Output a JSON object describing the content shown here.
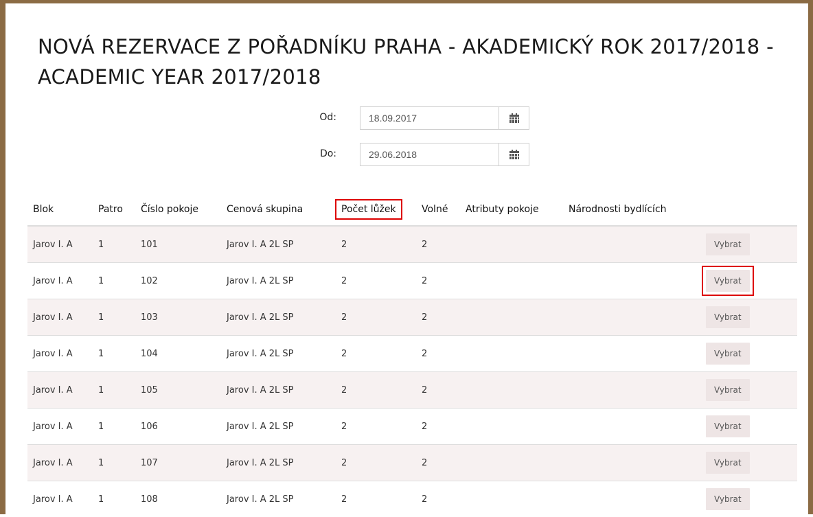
{
  "page": {
    "title": "NOVÁ REZERVACE Z POŘADNÍKU PRAHA - AKADEMICKÝ ROK 2017/2018 - ACADEMIC YEAR 2017/2018"
  },
  "dates": {
    "from_label": "Od:",
    "from_value": "18.09.2017",
    "to_label": "Do:",
    "to_value": "29.06.2018",
    "icon": "calendar-icon"
  },
  "table": {
    "headers": [
      "Blok",
      "Patro",
      "Číslo pokoje",
      "Cenová skupina",
      "Počet lůžek",
      "Volné",
      "Atributy pokoje",
      "Národnosti bydlících",
      ""
    ],
    "highlighted_header": "Počet lůžek",
    "rows": [
      {
        "blok": "Jarov I. A",
        "patro": "1",
        "cislo": "101",
        "cenova": "Jarov I. A 2L SP",
        "pocet": "2",
        "volne": "2",
        "atributy": "",
        "narodnosti": "",
        "action": "Vybrat"
      },
      {
        "blok": "Jarov I. A",
        "patro": "1",
        "cislo": "102",
        "cenova": "Jarov I. A 2L SP",
        "pocet": "2",
        "volne": "2",
        "atributy": "",
        "narodnosti": "",
        "action": "Vybrat"
      },
      {
        "blok": "Jarov I. A",
        "patro": "1",
        "cislo": "103",
        "cenova": "Jarov I. A 2L SP",
        "pocet": "2",
        "volne": "2",
        "atributy": "",
        "narodnosti": "",
        "action": "Vybrat"
      },
      {
        "blok": "Jarov I. A",
        "patro": "1",
        "cislo": "104",
        "cenova": "Jarov I. A 2L SP",
        "pocet": "2",
        "volne": "2",
        "atributy": "",
        "narodnosti": "",
        "action": "Vybrat"
      },
      {
        "blok": "Jarov I. A",
        "patro": "1",
        "cislo": "105",
        "cenova": "Jarov I. A 2L SP",
        "pocet": "2",
        "volne": "2",
        "atributy": "",
        "narodnosti": "",
        "action": "Vybrat"
      },
      {
        "blok": "Jarov I. A",
        "patro": "1",
        "cislo": "106",
        "cenova": "Jarov I. A 2L SP",
        "pocet": "2",
        "volne": "2",
        "atributy": "",
        "narodnosti": "",
        "action": "Vybrat"
      },
      {
        "blok": "Jarov I. A",
        "patro": "1",
        "cislo": "107",
        "cenova": "Jarov I. A 2L SP",
        "pocet": "2",
        "volne": "2",
        "atributy": "",
        "narodnosti": "",
        "action": "Vybrat"
      },
      {
        "blok": "Jarov I. A",
        "patro": "1",
        "cislo": "108",
        "cenova": "Jarov I. A 2L SP",
        "pocet": "2",
        "volne": "2",
        "atributy": "",
        "narodnosti": "",
        "action": "Vybrat"
      }
    ]
  },
  "colors": {
    "frame": "#8b6b44",
    "highlight": "#dd0000",
    "row_alt": "#f7f1f1",
    "button_bg": "#eee5e5"
  }
}
